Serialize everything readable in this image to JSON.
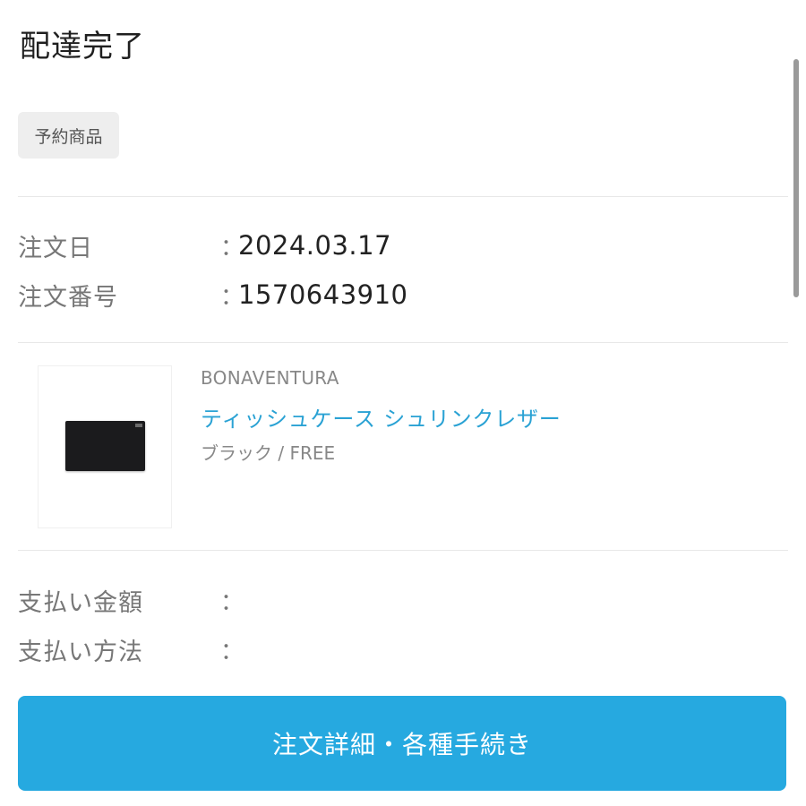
{
  "header": {
    "status_title": "配達完了"
  },
  "tag": {
    "label": "予約商品"
  },
  "order": {
    "date_label": "注文日",
    "date_colon": "：",
    "date_value": "2024.03.17",
    "number_label": "注文番号",
    "number_colon": "：",
    "number_value": "1570643910"
  },
  "product": {
    "brand": "BONAVENTURA",
    "name": "ティッシュケース シュリンクレザー",
    "variant": "ブラック / FREE",
    "name_color": "#2aa2d4"
  },
  "payment": {
    "amount_label": "支払い金額",
    "amount_colon": "：",
    "method_label": "支払い方法",
    "method_colon": "："
  },
  "actions": {
    "detail_button_label": "注文詳細・各種手続き",
    "button_color": "#26a9e0"
  }
}
